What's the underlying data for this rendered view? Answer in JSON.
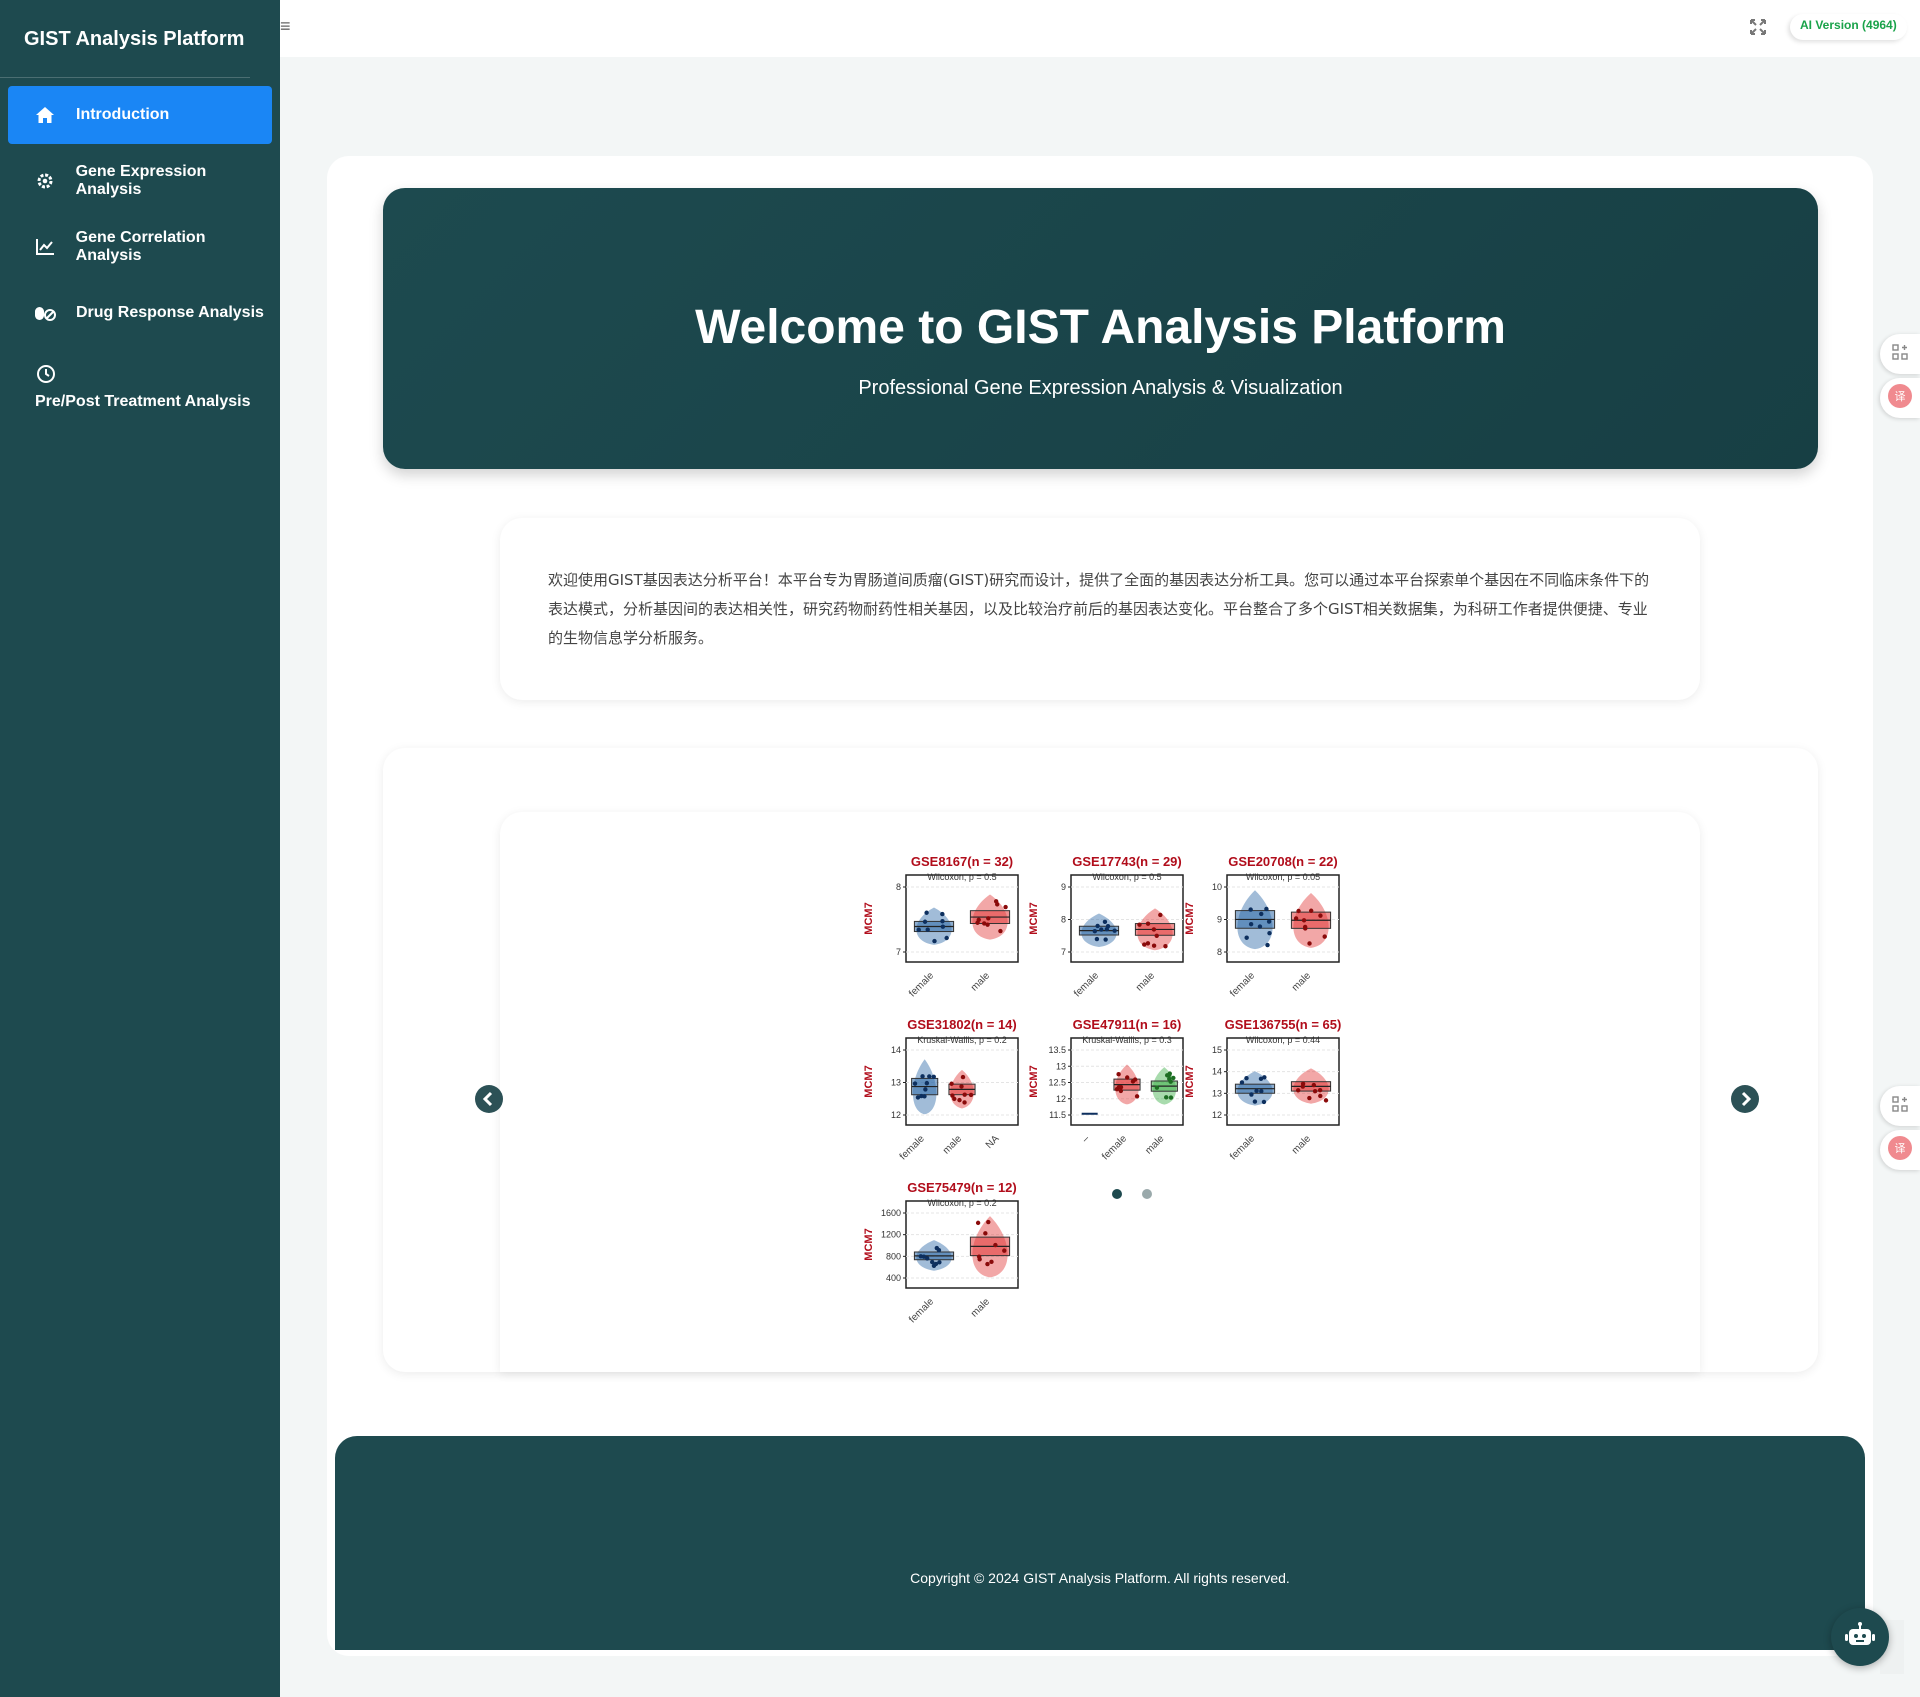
{
  "app": {
    "brand": "GIST Analysis Platform"
  },
  "sidebar": {
    "items": [
      {
        "label": "Introduction",
        "icon": "home-icon",
        "active": true
      },
      {
        "label": "Gene Expression Analysis",
        "icon": "gear-icon",
        "active": false
      },
      {
        "label": "Gene Correlation Analysis",
        "icon": "chart-line-icon",
        "active": false
      },
      {
        "label": "Drug Response Analysis",
        "icon": "pills-icon",
        "active": false
      },
      {
        "label": "Pre/Post Treatment Analysis",
        "icon": "clock-icon",
        "active": false
      }
    ]
  },
  "topbar": {
    "ai_version": "AI Version (4964)"
  },
  "hero": {
    "title": "Welcome to GIST Analysis Platform",
    "subtitle": "Professional Gene Expression Analysis & Visualization"
  },
  "intro": {
    "text": "欢迎使用GIST基因表达分析平台！本平台专为胃肠道间质瘤(GIST)研究而设计，提供了全面的基因表达分析工具。您可以通过本平台探索单个基因在不同临床条件下的表达模式，分析基因间的表达相关性，研究药物耐药性相关基因，以及比较治疗前后的基因表达变化。平台整合了多个GIST相关数据集，为科研工作者提供便捷、专业的生物信息学分析服务。"
  },
  "carousel": {
    "slide_count": 2,
    "active_slide": 0
  },
  "chart_data": [
    {
      "type": "box",
      "title": "GSE8167(n = 32)",
      "ylabel": "MCM7",
      "categories": [
        "female",
        "male"
      ],
      "yticks": [
        7,
        8
      ],
      "annotation": "Wilcoxon, p = 0.5"
    },
    {
      "type": "box",
      "title": "GSE17743(n = 29)",
      "ylabel": "MCM7",
      "categories": [
        "female",
        "male"
      ],
      "yticks": [
        7,
        8,
        9
      ],
      "annotation": "Wilcoxon, p = 0.5"
    },
    {
      "type": "box",
      "title": "GSE20708(n = 22)",
      "ylabel": "MCM7",
      "categories": [
        "female",
        "male"
      ],
      "yticks": [
        8,
        9,
        10
      ],
      "annotation": "Wilcoxon, p = 0.05"
    },
    {
      "type": "box",
      "title": "GSE31802(n = 14)",
      "ylabel": "MCM7",
      "categories": [
        "female",
        "male",
        "NA"
      ],
      "yticks": [
        12,
        13,
        14
      ],
      "annotation": "Kruskal-Wallis, p = 0.2"
    },
    {
      "type": "box",
      "title": "GSE47911(n = 16)",
      "ylabel": "MCM7",
      "categories": [
        "–",
        "female",
        "male"
      ],
      "yticks": [
        11.5,
        12.0,
        12.5,
        13.0,
        13.5
      ],
      "annotation": "Kruskal-Wallis, p = 0.3"
    },
    {
      "type": "box",
      "title": "GSE136755(n = 65)",
      "ylabel": "MCM7",
      "categories": [
        "female",
        "male"
      ],
      "yticks": [
        12,
        13,
        14,
        15
      ],
      "annotation": "Wilcoxon, p = 0.44"
    },
    {
      "type": "box",
      "title": "GSE75479(n = 12)",
      "ylabel": "MCM7",
      "categories": [
        "female",
        "male"
      ],
      "yticks": [
        400,
        800,
        1200,
        1600
      ],
      "annotation": "Wilcoxon, p = 0.2"
    }
  ],
  "colors": {
    "sidebar": "#1e4a4f",
    "active": "#1a86f5",
    "female": "#2f6aa8",
    "male": "#e23b3b",
    "third": "#3fb04a",
    "title_red": "#b10d1b"
  },
  "footer": {
    "copyright": "Copyright © 2024 GIST Analysis Platform. All rights reserved."
  }
}
